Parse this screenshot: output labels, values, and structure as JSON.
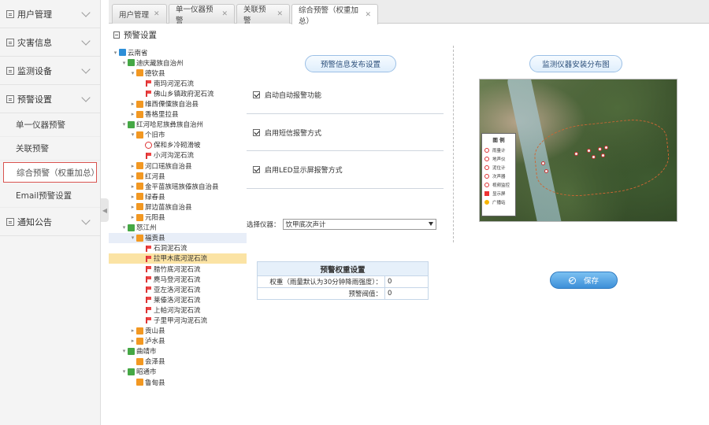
{
  "sidebar": {
    "menus": [
      {
        "label": "用户管理"
      },
      {
        "label": "灾害信息"
      },
      {
        "label": "监测设备"
      },
      {
        "label": "预警设置",
        "sub": [
          {
            "label": "单一仪器预警"
          },
          {
            "label": "关联预警"
          },
          {
            "label": "综合预警（权重加总）",
            "active": true
          },
          {
            "label": "Email预警设置"
          }
        ]
      },
      {
        "label": "通知公告"
      }
    ]
  },
  "tabs": [
    {
      "label": "用户管理"
    },
    {
      "label": "单一仪器预警"
    },
    {
      "label": "关联预警"
    },
    {
      "label": "综合预警（权重加总）",
      "active": true
    }
  ],
  "panel": {
    "title": "预警设置"
  },
  "tree": [
    {
      "label": "云南省",
      "icon": "prov",
      "level": 0,
      "toggle": "−"
    },
    {
      "label": "迪庆藏族自治州",
      "icon": "pref",
      "level": 1,
      "toggle": "−"
    },
    {
      "label": "德钦县",
      "icon": "county",
      "level": 2,
      "toggle": "−"
    },
    {
      "label": "南玛河泥石流",
      "icon": "flag",
      "level": 3
    },
    {
      "label": "佛山乡镇政府泥石流",
      "icon": "flag",
      "level": 3
    },
    {
      "label": "维西傈僳族自治县",
      "icon": "county",
      "level": 2,
      "toggle": "+"
    },
    {
      "label": "香格里拉县",
      "icon": "county",
      "level": 2,
      "toggle": "+"
    },
    {
      "label": "红河哈尼族彝族自治州",
      "icon": "pref",
      "level": 1,
      "toggle": "−"
    },
    {
      "label": "个旧市",
      "icon": "county",
      "level": 2,
      "toggle": "−"
    },
    {
      "label": "保和乡冷砌滑坡",
      "icon": "ring",
      "level": 3
    },
    {
      "label": "小河沟泥石流",
      "icon": "flag",
      "level": 3
    },
    {
      "label": "河口瑶族自治县",
      "icon": "county",
      "level": 2,
      "toggle": "+"
    },
    {
      "label": "红河县",
      "icon": "county",
      "level": 2,
      "toggle": "+"
    },
    {
      "label": "金平苗族瑶族傣族自治县",
      "icon": "county",
      "level": 2,
      "toggle": "+"
    },
    {
      "label": "绿春县",
      "icon": "county",
      "level": 2,
      "toggle": "+"
    },
    {
      "label": "屏边苗族自治县",
      "icon": "county",
      "level": 2,
      "toggle": "+"
    },
    {
      "label": "元阳县",
      "icon": "county",
      "level": 2,
      "toggle": "+"
    },
    {
      "label": "怒江州",
      "icon": "pref",
      "level": 1,
      "toggle": "−"
    },
    {
      "label": "福贡县",
      "icon": "county",
      "level": 2,
      "toggle": "−",
      "state": "hover"
    },
    {
      "label": "石洞泥石流",
      "icon": "flag",
      "level": 3
    },
    {
      "label": "拉甲木底河泥石流",
      "icon": "flag",
      "level": 3,
      "state": "selected"
    },
    {
      "label": "腊竹底河泥石流",
      "icon": "flag",
      "level": 3
    },
    {
      "label": "麂马登河泥石流",
      "icon": "flag",
      "level": 3
    },
    {
      "label": "亚左洛河泥石流",
      "icon": "flag",
      "level": 3
    },
    {
      "label": "莱傣洛河泥石流",
      "icon": "flag",
      "level": 3
    },
    {
      "label": "上帕河沟泥石流",
      "icon": "flag",
      "level": 3
    },
    {
      "label": "子里甲河沟泥石流",
      "icon": "flag",
      "level": 3
    },
    {
      "label": "贡山县",
      "icon": "county",
      "level": 2,
      "toggle": "+"
    },
    {
      "label": "泸水县",
      "icon": "county",
      "level": 2,
      "toggle": "+"
    },
    {
      "label": "曲靖市",
      "icon": "pref",
      "level": 1,
      "toggle": "−"
    },
    {
      "label": "会泽县",
      "icon": "county",
      "level": 2
    },
    {
      "label": "昭通市",
      "icon": "pref",
      "level": 1,
      "toggle": "−"
    },
    {
      "label": "鲁甸县",
      "icon": "county",
      "level": 2
    }
  ],
  "warning_settings": {
    "header": "预警信息发布设置",
    "options": [
      {
        "label": "启动自动报警功能",
        "checked": true
      },
      {
        "label": "启用短信报警方式",
        "checked": true
      },
      {
        "label": "启用LED显示屏报警方式",
        "checked": true
      }
    ],
    "instrument_label": "选择仪器：",
    "instrument_value": "饮甲底次声计"
  },
  "weight_table": {
    "title": "预警权重设置",
    "rows": [
      {
        "label": "权重（雨量默认为30分钟降雨强度）：",
        "value": "0"
      },
      {
        "label": "预警阀值：",
        "value": "0"
      }
    ]
  },
  "save_label": "保存",
  "map_section": {
    "header": "监测仪器安装分布图",
    "legend_title": "图 例",
    "legend_items": [
      "雨量计",
      "地声仪",
      "泥位计",
      "次声器",
      "视频监控",
      "显示屏",
      "广播站"
    ]
  }
}
